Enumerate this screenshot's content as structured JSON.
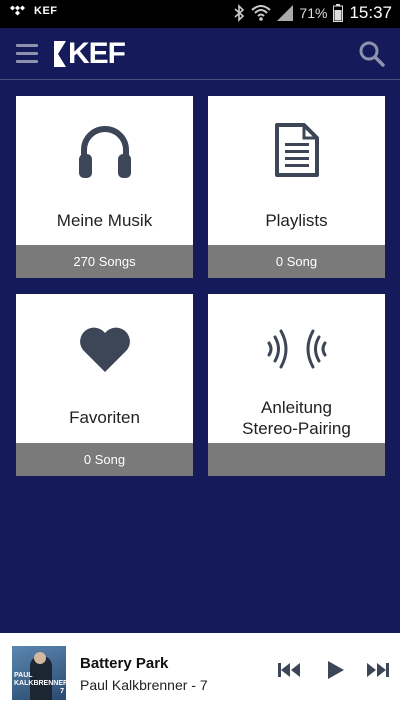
{
  "status_bar": {
    "left_label": "KEF",
    "battery": "71%",
    "time": "15:37"
  },
  "app_bar": {
    "logo": "KEF"
  },
  "tiles": [
    {
      "title": "Meine Musik",
      "footer": "270 Songs",
      "icon": "headphones-icon"
    },
    {
      "title": "Playlists",
      "footer": "0 Song",
      "icon": "document-icon"
    },
    {
      "title": "Favoriten",
      "footer": "0 Song",
      "icon": "heart-icon"
    },
    {
      "title_line1": "Anleitung",
      "title_line2": "Stereo-Pairing",
      "footer": "",
      "icon": "sound-waves-icon"
    }
  ],
  "player": {
    "title": "Battery Park",
    "artist": "Paul Kalkbrenner - 7",
    "album_art_text_line1": "PAUL",
    "album_art_text_line2": "KALKBRENNER",
    "album_art_text_line3": "7"
  },
  "colors": {
    "background": "#141a5a",
    "tile_footer": "#7a7a7a",
    "icon": "#3d4657"
  }
}
